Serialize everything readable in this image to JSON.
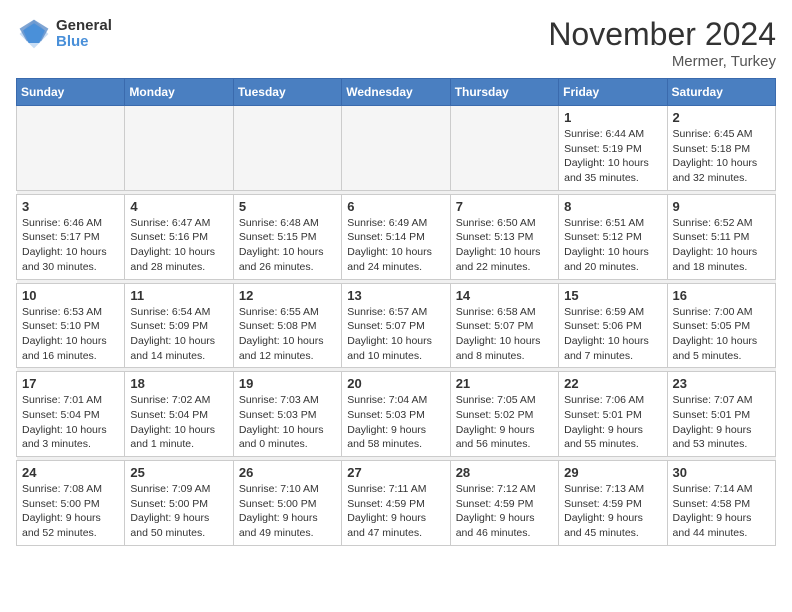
{
  "logo": {
    "general": "General",
    "blue": "Blue"
  },
  "title": "November 2024",
  "subtitle": "Mermer, Turkey",
  "weekdays": [
    "Sunday",
    "Monday",
    "Tuesday",
    "Wednesday",
    "Thursday",
    "Friday",
    "Saturday"
  ],
  "weeks": [
    [
      {
        "day": "",
        "info": ""
      },
      {
        "day": "",
        "info": ""
      },
      {
        "day": "",
        "info": ""
      },
      {
        "day": "",
        "info": ""
      },
      {
        "day": "",
        "info": ""
      },
      {
        "day": "1",
        "info": "Sunrise: 6:44 AM\nSunset: 5:19 PM\nDaylight: 10 hours\nand 35 minutes."
      },
      {
        "day": "2",
        "info": "Sunrise: 6:45 AM\nSunset: 5:18 PM\nDaylight: 10 hours\nand 32 minutes."
      }
    ],
    [
      {
        "day": "3",
        "info": "Sunrise: 6:46 AM\nSunset: 5:17 PM\nDaylight: 10 hours\nand 30 minutes."
      },
      {
        "day": "4",
        "info": "Sunrise: 6:47 AM\nSunset: 5:16 PM\nDaylight: 10 hours\nand 28 minutes."
      },
      {
        "day": "5",
        "info": "Sunrise: 6:48 AM\nSunset: 5:15 PM\nDaylight: 10 hours\nand 26 minutes."
      },
      {
        "day": "6",
        "info": "Sunrise: 6:49 AM\nSunset: 5:14 PM\nDaylight: 10 hours\nand 24 minutes."
      },
      {
        "day": "7",
        "info": "Sunrise: 6:50 AM\nSunset: 5:13 PM\nDaylight: 10 hours\nand 22 minutes."
      },
      {
        "day": "8",
        "info": "Sunrise: 6:51 AM\nSunset: 5:12 PM\nDaylight: 10 hours\nand 20 minutes."
      },
      {
        "day": "9",
        "info": "Sunrise: 6:52 AM\nSunset: 5:11 PM\nDaylight: 10 hours\nand 18 minutes."
      }
    ],
    [
      {
        "day": "10",
        "info": "Sunrise: 6:53 AM\nSunset: 5:10 PM\nDaylight: 10 hours\nand 16 minutes."
      },
      {
        "day": "11",
        "info": "Sunrise: 6:54 AM\nSunset: 5:09 PM\nDaylight: 10 hours\nand 14 minutes."
      },
      {
        "day": "12",
        "info": "Sunrise: 6:55 AM\nSunset: 5:08 PM\nDaylight: 10 hours\nand 12 minutes."
      },
      {
        "day": "13",
        "info": "Sunrise: 6:57 AM\nSunset: 5:07 PM\nDaylight: 10 hours\nand 10 minutes."
      },
      {
        "day": "14",
        "info": "Sunrise: 6:58 AM\nSunset: 5:07 PM\nDaylight: 10 hours\nand 8 minutes."
      },
      {
        "day": "15",
        "info": "Sunrise: 6:59 AM\nSunset: 5:06 PM\nDaylight: 10 hours\nand 7 minutes."
      },
      {
        "day": "16",
        "info": "Sunrise: 7:00 AM\nSunset: 5:05 PM\nDaylight: 10 hours\nand 5 minutes."
      }
    ],
    [
      {
        "day": "17",
        "info": "Sunrise: 7:01 AM\nSunset: 5:04 PM\nDaylight: 10 hours\nand 3 minutes."
      },
      {
        "day": "18",
        "info": "Sunrise: 7:02 AM\nSunset: 5:04 PM\nDaylight: 10 hours\nand 1 minute."
      },
      {
        "day": "19",
        "info": "Sunrise: 7:03 AM\nSunset: 5:03 PM\nDaylight: 10 hours\nand 0 minutes."
      },
      {
        "day": "20",
        "info": "Sunrise: 7:04 AM\nSunset: 5:03 PM\nDaylight: 9 hours\nand 58 minutes."
      },
      {
        "day": "21",
        "info": "Sunrise: 7:05 AM\nSunset: 5:02 PM\nDaylight: 9 hours\nand 56 minutes."
      },
      {
        "day": "22",
        "info": "Sunrise: 7:06 AM\nSunset: 5:01 PM\nDaylight: 9 hours\nand 55 minutes."
      },
      {
        "day": "23",
        "info": "Sunrise: 7:07 AM\nSunset: 5:01 PM\nDaylight: 9 hours\nand 53 minutes."
      }
    ],
    [
      {
        "day": "24",
        "info": "Sunrise: 7:08 AM\nSunset: 5:00 PM\nDaylight: 9 hours\nand 52 minutes."
      },
      {
        "day": "25",
        "info": "Sunrise: 7:09 AM\nSunset: 5:00 PM\nDaylight: 9 hours\nand 50 minutes."
      },
      {
        "day": "26",
        "info": "Sunrise: 7:10 AM\nSunset: 5:00 PM\nDaylight: 9 hours\nand 49 minutes."
      },
      {
        "day": "27",
        "info": "Sunrise: 7:11 AM\nSunset: 4:59 PM\nDaylight: 9 hours\nand 47 minutes."
      },
      {
        "day": "28",
        "info": "Sunrise: 7:12 AM\nSunset: 4:59 PM\nDaylight: 9 hours\nand 46 minutes."
      },
      {
        "day": "29",
        "info": "Sunrise: 7:13 AM\nSunset: 4:59 PM\nDaylight: 9 hours\nand 45 minutes."
      },
      {
        "day": "30",
        "info": "Sunrise: 7:14 AM\nSunset: 4:58 PM\nDaylight: 9 hours\nand 44 minutes."
      }
    ]
  ]
}
